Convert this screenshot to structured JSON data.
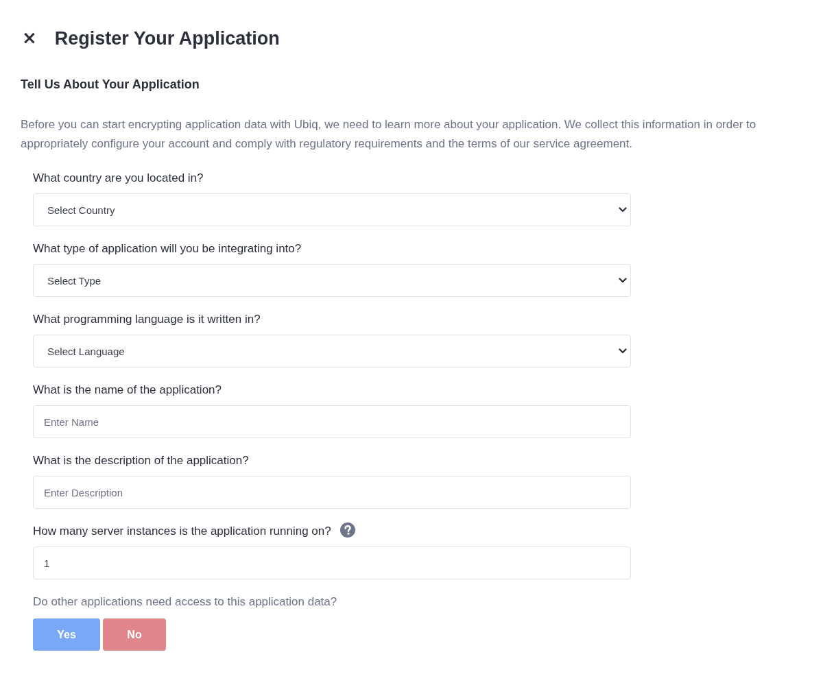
{
  "header": {
    "close_label": "×",
    "title": "Register Your Application"
  },
  "section_title": "Tell Us About Your Application",
  "intro": "Before you can start encrypting application data with Ubiq, we need to learn more about your application. We collect this information in order to appropriately configure your account and comply with regulatory requirements and the terms of our service agreement.",
  "fields": [
    {
      "kind": "select",
      "label": "What country are you located in?",
      "value": "Select Country",
      "help_icon": false
    },
    {
      "kind": "select",
      "label": "What type of application will you be integrating into?",
      "value": "Select Type",
      "help_icon": false
    },
    {
      "kind": "select",
      "label": "What programming language is it written in?",
      "value": "Select Language",
      "help_icon": false
    },
    {
      "kind": "input",
      "label": "What is the name of the application?",
      "placeholder": "Enter Name",
      "help_icon": false
    },
    {
      "kind": "input",
      "label": "What is the description of the application?",
      "placeholder": "Enter Description",
      "help_icon": false
    },
    {
      "kind": "input",
      "label": "How many server instances is the application running on?",
      "value": "1",
      "help_icon": true
    }
  ],
  "access_question": {
    "label": "Do other applications need access to this application data?",
    "buttons": [
      {
        "label": "Yes",
        "color": "#7ba7f7"
      },
      {
        "label": "No",
        "color": "#e0868b"
      }
    ]
  }
}
